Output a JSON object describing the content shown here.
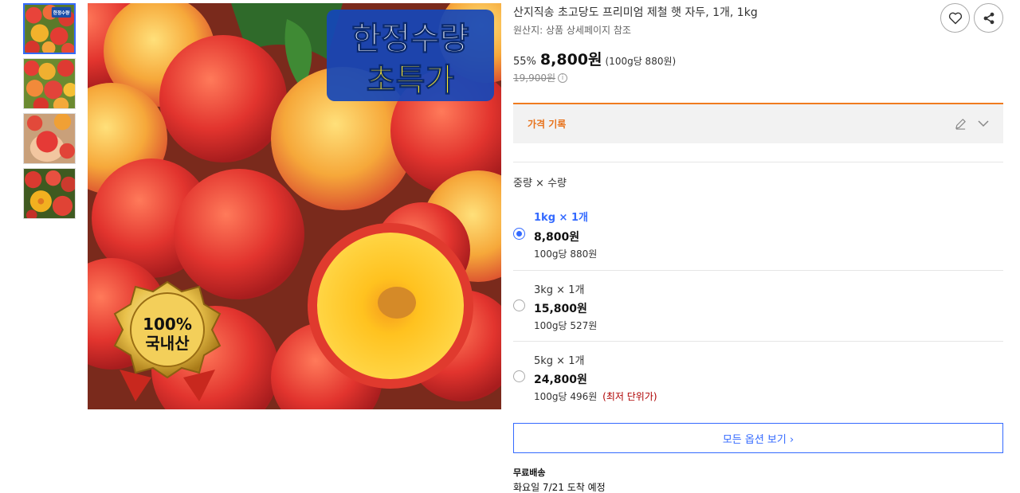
{
  "thumbnails": [
    {
      "name": "thumb-1",
      "badge": "한정수량"
    },
    {
      "name": "thumb-2"
    },
    {
      "name": "thumb-3"
    },
    {
      "name": "thumb-4"
    }
  ],
  "main_image": {
    "banner_line1": "한정수량",
    "banner_line2": "초특가",
    "seal_line1": "100%",
    "seal_line2": "국내산"
  },
  "product": {
    "title": "산지직송 초고당도 프리미엄 제철 햇 자두, 1개, 1kg",
    "origin": "원산지: 상품 상세페이지 참조",
    "discount": "55%",
    "price": "8,800원",
    "unit_price": "(100g당 880원)",
    "original_price": "19,900원"
  },
  "icons": {
    "heart": "heart-icon",
    "share": "share-icon",
    "info": "info-icon",
    "pencil": "pencil-icon",
    "chevron": "chevron-down-icon"
  },
  "price_history": {
    "label": "가격 기록"
  },
  "options": {
    "heading": "중량 × 수량",
    "items": [
      {
        "label": "1kg × 1개",
        "price": "8,800원",
        "unit": "100g당 880원",
        "best": "",
        "selected": true
      },
      {
        "label": "3kg × 1개",
        "price": "15,800원",
        "unit": "100g당 527원",
        "best": "",
        "selected": false
      },
      {
        "label": "5kg × 1개",
        "price": "24,800원",
        "unit": "100g당 496원",
        "best": "(최저 단위가)",
        "selected": false
      }
    ],
    "view_all": "모든 옵션 보기 ›"
  },
  "shipping": {
    "title": "무료배송",
    "arrival": "화요일 7/21 도착 예정"
  },
  "colors": {
    "accent_blue": "#346aff",
    "orange": "#f07b1f",
    "best_red": "#ae0000"
  }
}
